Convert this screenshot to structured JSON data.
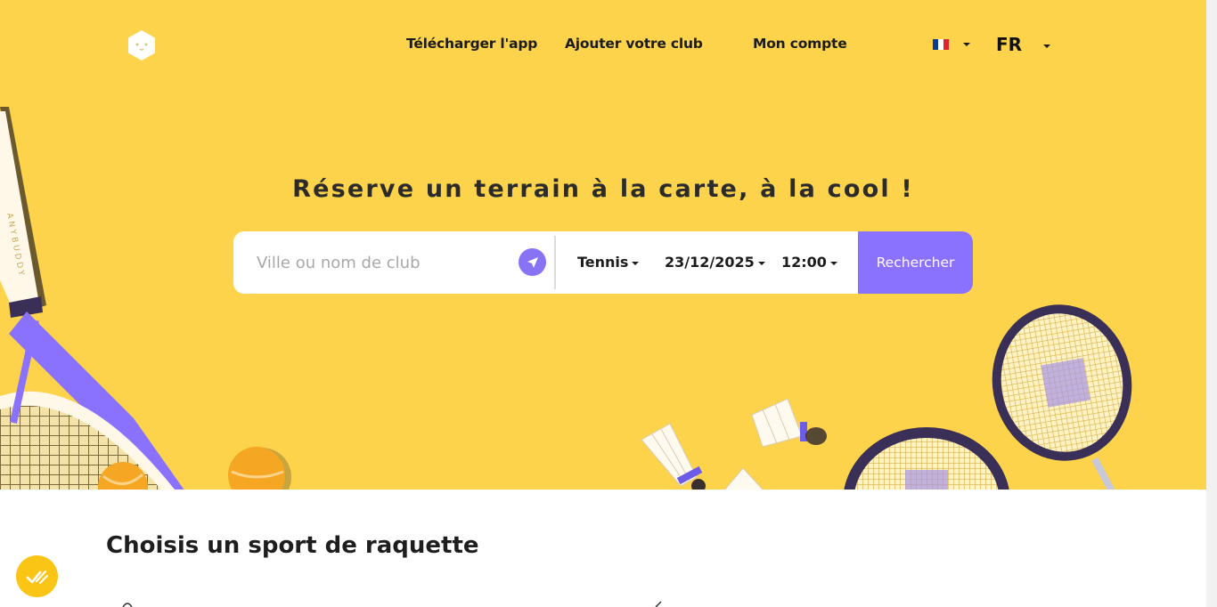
{
  "header": {
    "logo_icon": "anybuddy-face-logo-icon",
    "nav": {
      "download_app": "Télécharger l'app",
      "add_club": "Ajouter votre club",
      "my_account": "Mon compte"
    },
    "flag_icon": "france-flag-icon",
    "language": "FR"
  },
  "hero": {
    "headline": "Réserve un terrain à la carte, à la cool !",
    "racket_brand_text": "ANYBUDDY"
  },
  "search": {
    "placeholder": "Ville ou nom de club",
    "locate_icon": "location-arrow-icon",
    "sport": "Tennis",
    "date": "23/12/2025",
    "time": "12:00",
    "submit_label": "Rechercher"
  },
  "section": {
    "title": "Choisis un sport de raquette"
  },
  "chat": {
    "icon": "chat-check-icon"
  },
  "colors": {
    "hero_background": "#fdd34b",
    "accent_purple": "#8a72ff",
    "chat_button": "#fbc516"
  }
}
